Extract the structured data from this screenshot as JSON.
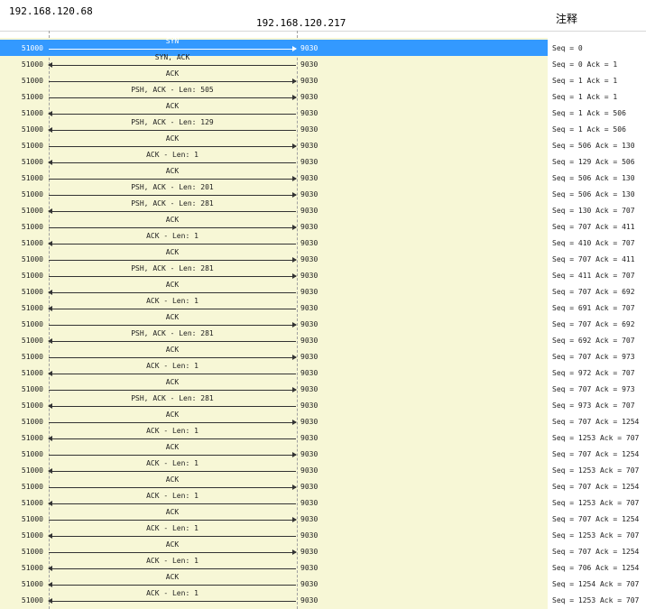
{
  "header": {
    "host_left": "192.168.120.68",
    "host_right": "192.168.120.217",
    "notes_title": "注释"
  },
  "rows": [
    {
      "src": "51000",
      "dst": "9030",
      "label": "SYN",
      "dir": "r",
      "note": "Seq = 0",
      "selected": true
    },
    {
      "src": "51000",
      "dst": "9030",
      "label": "SYN, ACK",
      "dir": "l",
      "note": "Seq = 0 Ack = 1"
    },
    {
      "src": "51000",
      "dst": "9030",
      "label": "ACK",
      "dir": "r",
      "note": "Seq = 1 Ack = 1"
    },
    {
      "src": "51000",
      "dst": "9030",
      "label": "PSH, ACK - Len: 505",
      "dir": "r",
      "note": "Seq = 1 Ack = 1"
    },
    {
      "src": "51000",
      "dst": "9030",
      "label": "ACK",
      "dir": "l",
      "note": "Seq = 1 Ack = 506"
    },
    {
      "src": "51000",
      "dst": "9030",
      "label": "PSH, ACK - Len: 129",
      "dir": "l",
      "note": "Seq = 1 Ack = 506"
    },
    {
      "src": "51000",
      "dst": "9030",
      "label": "ACK",
      "dir": "r",
      "note": "Seq = 506 Ack = 130"
    },
    {
      "src": "51000",
      "dst": "9030",
      "label": "ACK - Len: 1",
      "dir": "l",
      "note": "Seq = 129 Ack = 506"
    },
    {
      "src": "51000",
      "dst": "9030",
      "label": "ACK",
      "dir": "r",
      "note": "Seq = 506 Ack = 130"
    },
    {
      "src": "51000",
      "dst": "9030",
      "label": "PSH, ACK - Len: 201",
      "dir": "r",
      "note": "Seq = 506 Ack = 130"
    },
    {
      "src": "51000",
      "dst": "9030",
      "label": "PSH, ACK - Len: 281",
      "dir": "l",
      "note": "Seq = 130 Ack = 707"
    },
    {
      "src": "51000",
      "dst": "9030",
      "label": "ACK",
      "dir": "r",
      "note": "Seq = 707 Ack = 411"
    },
    {
      "src": "51000",
      "dst": "9030",
      "label": "ACK - Len: 1",
      "dir": "l",
      "note": "Seq = 410 Ack = 707"
    },
    {
      "src": "51000",
      "dst": "9030",
      "label": "ACK",
      "dir": "r",
      "note": "Seq = 707 Ack = 411"
    },
    {
      "src": "51000",
      "dst": "9030",
      "label": "PSH, ACK - Len: 281",
      "dir": "r",
      "note": "Seq = 411 Ack = 707"
    },
    {
      "src": "51000",
      "dst": "9030",
      "label": "ACK",
      "dir": "l",
      "note": "Seq = 707 Ack = 692"
    },
    {
      "src": "51000",
      "dst": "9030",
      "label": "ACK - Len: 1",
      "dir": "l",
      "note": "Seq = 691 Ack = 707"
    },
    {
      "src": "51000",
      "dst": "9030",
      "label": "ACK",
      "dir": "r",
      "note": "Seq = 707 Ack = 692"
    },
    {
      "src": "51000",
      "dst": "9030",
      "label": "PSH, ACK - Len: 281",
      "dir": "l",
      "note": "Seq = 692 Ack = 707"
    },
    {
      "src": "51000",
      "dst": "9030",
      "label": "ACK",
      "dir": "r",
      "note": "Seq = 707 Ack = 973"
    },
    {
      "src": "51000",
      "dst": "9030",
      "label": "ACK - Len: 1",
      "dir": "l",
      "note": "Seq = 972 Ack = 707"
    },
    {
      "src": "51000",
      "dst": "9030",
      "label": "ACK",
      "dir": "r",
      "note": "Seq = 707 Ack = 973"
    },
    {
      "src": "51000",
      "dst": "9030",
      "label": "PSH, ACK - Len: 281",
      "dir": "l",
      "note": "Seq = 973 Ack = 707"
    },
    {
      "src": "51000",
      "dst": "9030",
      "label": "ACK",
      "dir": "r",
      "note": "Seq = 707 Ack = 1254"
    },
    {
      "src": "51000",
      "dst": "9030",
      "label": "ACK - Len: 1",
      "dir": "l",
      "note": "Seq = 1253 Ack = 707"
    },
    {
      "src": "51000",
      "dst": "9030",
      "label": "ACK",
      "dir": "r",
      "note": "Seq = 707 Ack = 1254"
    },
    {
      "src": "51000",
      "dst": "9030",
      "label": "ACK - Len: 1",
      "dir": "l",
      "note": "Seq = 1253 Ack = 707"
    },
    {
      "src": "51000",
      "dst": "9030",
      "label": "ACK",
      "dir": "r",
      "note": "Seq = 707 Ack = 1254"
    },
    {
      "src": "51000",
      "dst": "9030",
      "label": "ACK - Len: 1",
      "dir": "l",
      "note": "Seq = 1253 Ack = 707"
    },
    {
      "src": "51000",
      "dst": "9030",
      "label": "ACK",
      "dir": "r",
      "note": "Seq = 707 Ack = 1254"
    },
    {
      "src": "51000",
      "dst": "9030",
      "label": "ACK - Len: 1",
      "dir": "l",
      "note": "Seq = 1253 Ack = 707"
    },
    {
      "src": "51000",
      "dst": "9030",
      "label": "ACK",
      "dir": "r",
      "note": "Seq = 707 Ack = 1254"
    },
    {
      "src": "51000",
      "dst": "9030",
      "label": "ACK - Len: 1",
      "dir": "l",
      "note": "Seq = 706 Ack = 1254"
    },
    {
      "src": "51000",
      "dst": "9030",
      "label": "ACK",
      "dir": "l",
      "note": "Seq = 1254 Ack = 707"
    },
    {
      "src": "51000",
      "dst": "9030",
      "label": "ACK - Len: 1",
      "dir": "l",
      "note": "Seq = 1253 Ack = 707"
    }
  ]
}
